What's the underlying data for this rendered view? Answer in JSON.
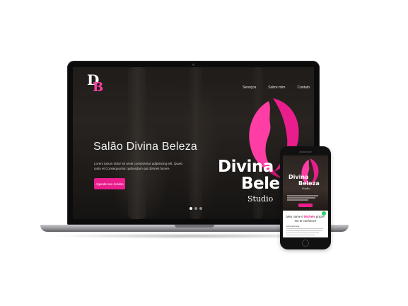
{
  "site": {
    "logo_letters": [
      "D",
      "B"
    ],
    "nav": [
      "Serviços",
      "Sobre mim",
      "Contato"
    ],
    "hero_title": "Salão Divina Beleza",
    "hero_description": "Lorem ipsum dolor sit amet consectetur adipisicing elit. Quasi iusto et Consequuntur quibusdam qui dolores facere.",
    "hero_button": "Agende seu horário",
    "brand": {
      "line1": "Divina",
      "line2": "Beleza",
      "line3": "Studio"
    },
    "slider_dots": 3,
    "active_dot": 0
  },
  "mobile": {
    "brand": {
      "line1": "Divina",
      "line2": "Beleza",
      "line3": "Studio"
    },
    "intro_prefix": "Meu nome é ",
    "intro_name": "Michele",
    "intro_suffix": " prazer em te conhecer!",
    "subheading": "● Experiência"
  },
  "colors": {
    "accent": "#e91e8c",
    "device_frame": "#0b0b0c",
    "whatsapp": "#25d366"
  }
}
